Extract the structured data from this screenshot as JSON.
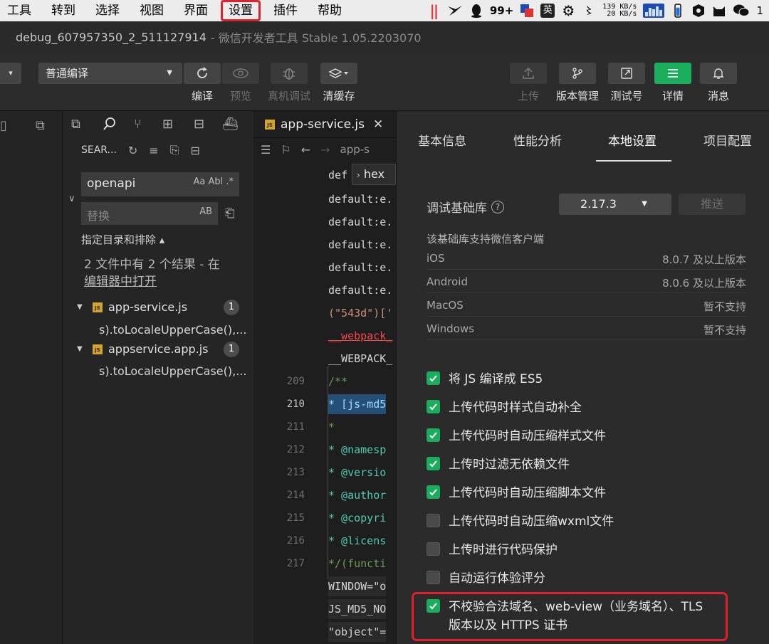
{
  "menubar": {
    "items": [
      "工具",
      "转到",
      "选择",
      "视图",
      "界面",
      "设置",
      "插件",
      "帮助"
    ],
    "highlighted_index": 5,
    "tray": {
      "badge": "99+",
      "ime": "英",
      "net_up": "139 KB/s",
      "net_down": "20 KB/s",
      "wechat_count": "1"
    }
  },
  "titlebar": {
    "project": "debug_607957350_2_511127914",
    "app": "- 微信开发者工具 Stable 1.05.2203070"
  },
  "toolbar": {
    "compile_mode": "普通编译",
    "labels": {
      "compile": "编译",
      "preview": "预览",
      "remote_debug": "真机调试",
      "clear_cache": "清缓存",
      "upload": "上传",
      "version": "版本管理",
      "test": "测试号",
      "details": "详情",
      "messages": "消息"
    }
  },
  "search": {
    "header": "SEAR...",
    "query": "openapi",
    "replace_placeholder": "替换",
    "options": "Aa  Abl  .*",
    "replace_opts": "AB",
    "scope_label": "指定目录和排除 ▴",
    "results_line1": "2 文件中有 2 个结果 - 在",
    "results_link": "编辑器中打开",
    "results": [
      {
        "file": "app-service.js",
        "count": "1",
        "match": "s).toLocaleUpperCase(),..."
      },
      {
        "file": "appservice.app.js",
        "count": "1",
        "match": "s).toLocaleUpperCase(),..."
      }
    ]
  },
  "editor": {
    "tab_title": "app-service.js",
    "breadcrumb": "app-s",
    "hex_popup": "hex",
    "lines": [
      {
        "num": "",
        "text": "def"
      },
      {
        "num": "",
        "text": "default:e."
      },
      {
        "num": "",
        "text": "default:e."
      },
      {
        "num": "",
        "text": "default:e."
      },
      {
        "num": "",
        "text": "default:e."
      },
      {
        "num": "",
        "text": "default:e."
      },
      {
        "num": "",
        "text": "(\"543d\")['"
      },
      {
        "num": "",
        "text": "__webpack_"
      },
      {
        "num": "",
        "text": "__WEBPACK_"
      },
      {
        "num": "209",
        "text": "/**"
      },
      {
        "num": "210",
        "text": " * [js-md5"
      },
      {
        "num": "211",
        "text": " *"
      },
      {
        "num": "212",
        "text": " * @namesp"
      },
      {
        "num": "213",
        "text": " * @versio"
      },
      {
        "num": "214",
        "text": " * @author"
      },
      {
        "num": "215",
        "text": " * @copyri"
      },
      {
        "num": "216",
        "text": " * @licens"
      },
      {
        "num": "217",
        "text": " */(functi"
      },
      {
        "num": "",
        "text": "WINDOW=\"o"
      },
      {
        "num": "",
        "text": "JS_MD5_NO"
      },
      {
        "num": "",
        "text": "\"object\"="
      }
    ]
  },
  "panel": {
    "tabs": [
      "基本信息",
      "性能分析",
      "本地设置",
      "项目配置"
    ],
    "active_tab": 2,
    "lib_label": "调试基础库",
    "lib_version": "2.17.3",
    "push_label": "推送",
    "support_title": "该基础库支持微信客户端",
    "support": [
      {
        "k": "iOS",
        "v": "8.0.7 及以上版本"
      },
      {
        "k": "Android",
        "v": "8.0.6 及以上版本"
      },
      {
        "k": "MacOS",
        "v": "暂不支持"
      },
      {
        "k": "Windows",
        "v": "暂不支持"
      }
    ],
    "options": [
      {
        "label": "将 JS 编译成 ES5",
        "checked": true
      },
      {
        "label": "上传代码时样式自动补全",
        "checked": true
      },
      {
        "label": "上传代码时自动压缩样式文件",
        "checked": true
      },
      {
        "label": "上传时过滤无依赖文件",
        "checked": true
      },
      {
        "label": "上传代码时自动压缩脚本文件",
        "checked": true
      },
      {
        "label": "上传代码时自动压缩wxml文件",
        "checked": false
      },
      {
        "label": "上传时进行代码保护",
        "checked": false
      },
      {
        "label": "自动运行体验评分",
        "checked": false
      },
      {
        "label": "不校验合法域名、web-view（业务域名）、TLS",
        "label2": "版本以及 HTTPS 证书",
        "checked": true
      }
    ]
  },
  "colors": {
    "accent_green": "#1aad5c",
    "highlight_red": "#e0202a"
  }
}
